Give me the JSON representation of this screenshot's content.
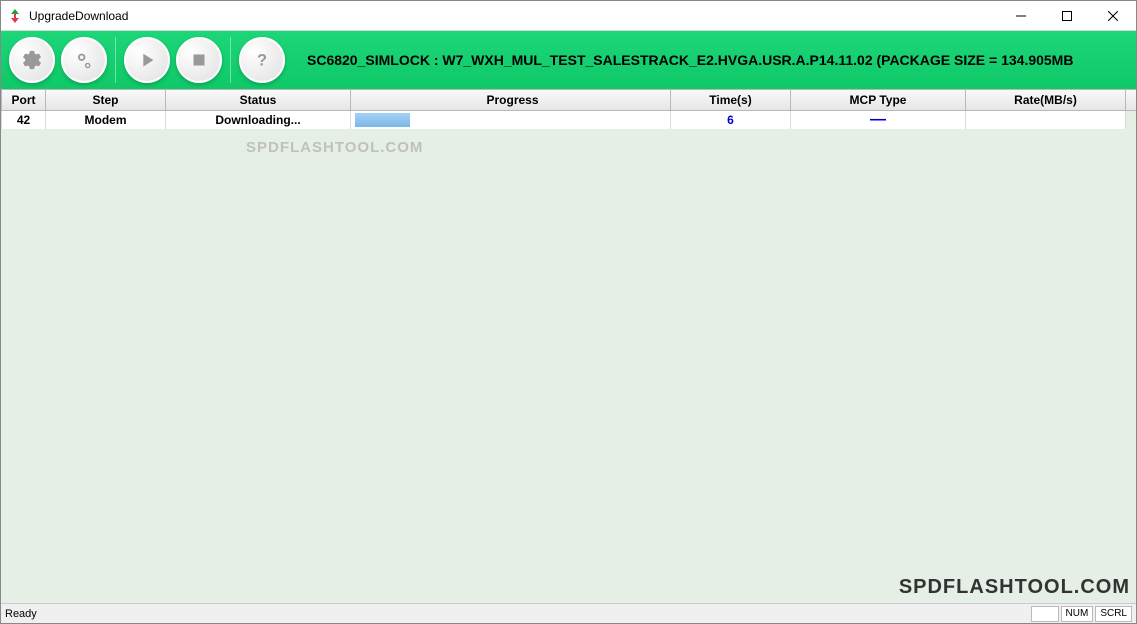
{
  "window": {
    "title": "UpgradeDownload"
  },
  "toolbar": {
    "package_info": "SC6820_SIMLOCK : W7_WXH_MUL_TEST_SALESTRACK_E2.HVGA.USR.A.P14.11.02 (PACKAGE SIZE = 134.905MB"
  },
  "table": {
    "headers": {
      "port": "Port",
      "step": "Step",
      "status": "Status",
      "progress": "Progress",
      "time": "Time(s)",
      "mcp": "MCP Type",
      "rate": "Rate(MB/s)"
    },
    "rows": [
      {
        "port": "42",
        "step": "Modem",
        "status": "Downloading...",
        "time": "6",
        "mcp": "—",
        "rate": ""
      }
    ]
  },
  "watermarks": {
    "center": "SPDFLASHTOOL.COM",
    "corner": "SPDFLASHTOOL.COM"
  },
  "statusbar": {
    "ready": "Ready",
    "num": "NUM",
    "scrl": "SCRL"
  }
}
